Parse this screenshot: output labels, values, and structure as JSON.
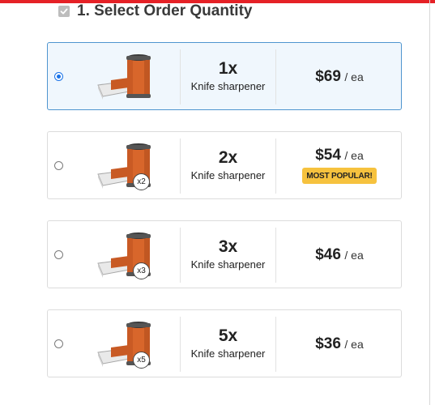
{
  "section": {
    "title": "1. Select Order Quantity"
  },
  "options": [
    {
      "qty_label": "1x",
      "product_name": "Knife sharpener",
      "price": "$69",
      "unit": "/ ea",
      "badge_qty": "",
      "popular_badge": "",
      "selected": true
    },
    {
      "qty_label": "2x",
      "product_name": "Knife sharpener",
      "price": "$54",
      "unit": "/ ea",
      "badge_qty": "x2",
      "popular_badge": "MOST POPULAR!",
      "selected": false
    },
    {
      "qty_label": "3x",
      "product_name": "Knife sharpener",
      "price": "$46",
      "unit": "/ ea",
      "badge_qty": "x3",
      "popular_badge": "",
      "selected": false
    },
    {
      "qty_label": "5x",
      "product_name": "Knife sharpener",
      "price": "$36",
      "unit": "/ ea",
      "badge_qty": "x5",
      "popular_badge": "",
      "selected": false
    }
  ],
  "colors": {
    "accent_top_bar": "#e52126",
    "selected_border": "#4f95cf",
    "selected_bg": "#f0f7fd",
    "popular_badge_bg": "#f6c23e",
    "product_body": "#d8662b"
  }
}
